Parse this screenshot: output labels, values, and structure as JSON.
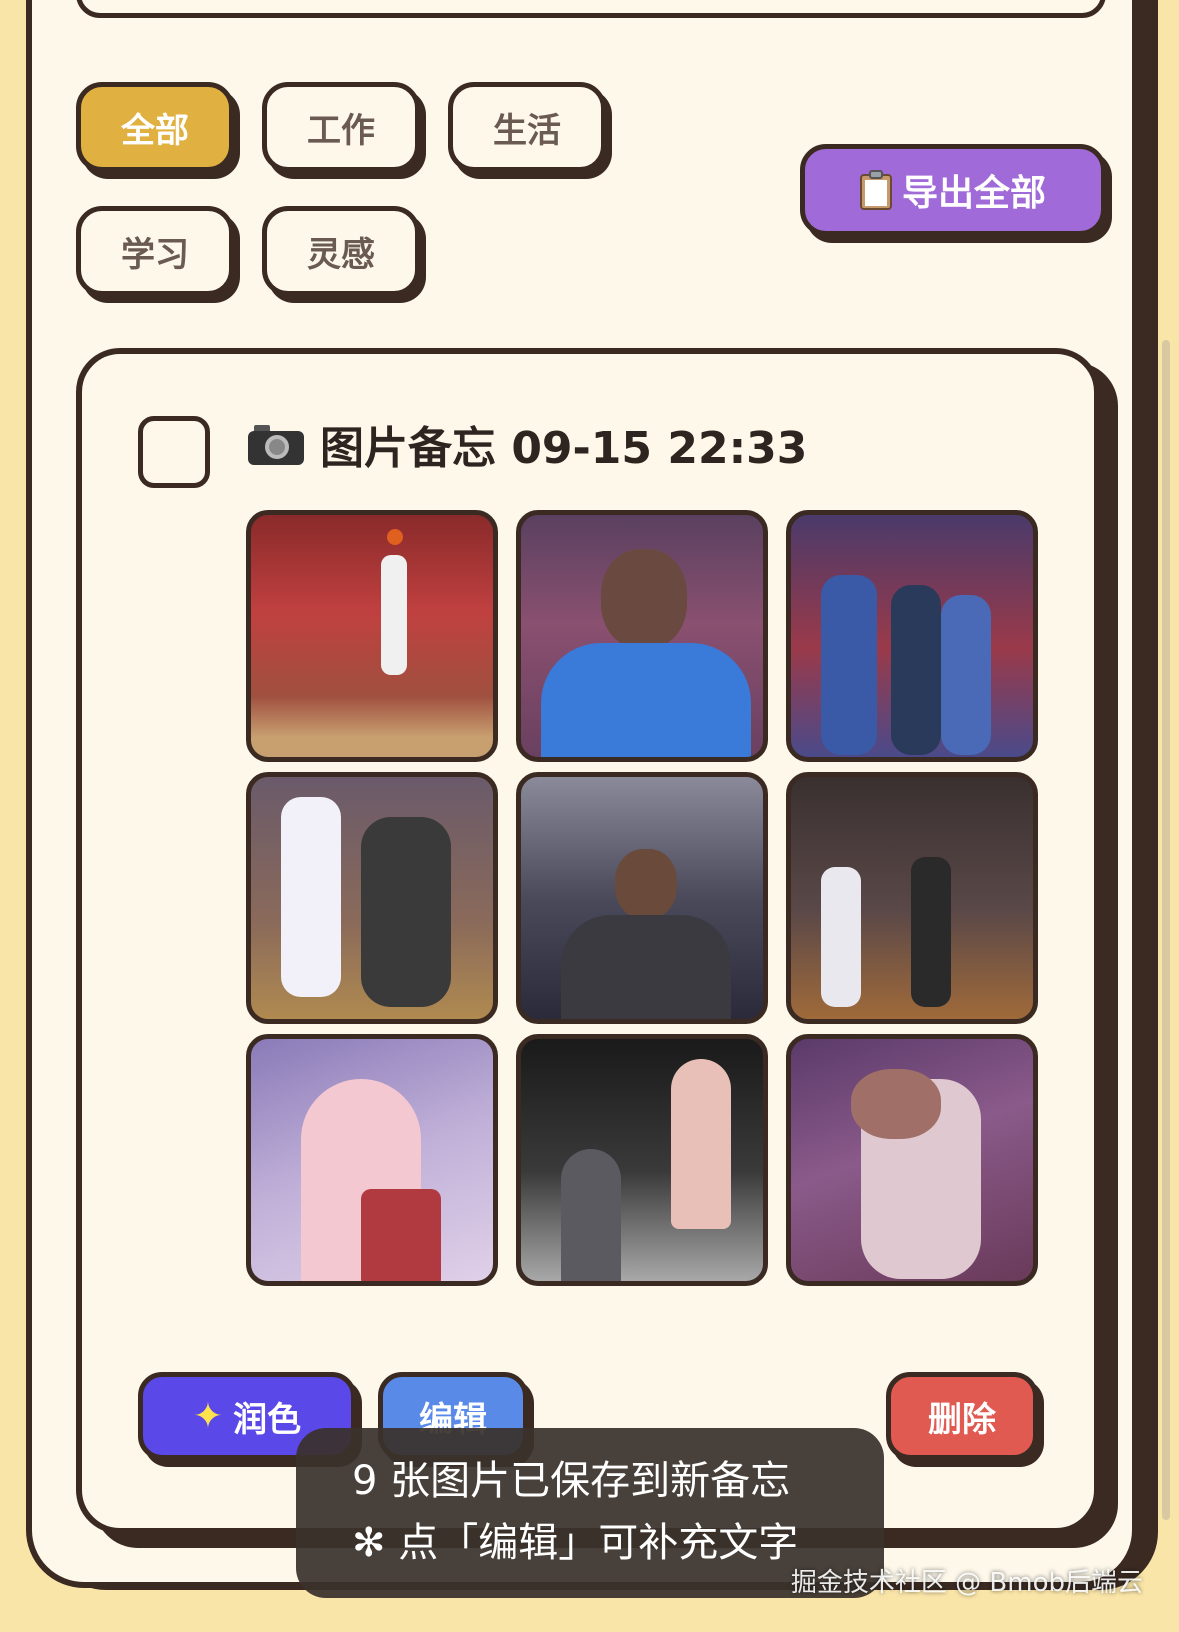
{
  "filters": {
    "all": "全部",
    "work": "工作",
    "life": "生活",
    "study": "学习",
    "inspiration": "灵感"
  },
  "export_label": "导出全部",
  "memo": {
    "title": "图片备忘 09-15 22:33",
    "image_count": 9
  },
  "actions": {
    "polish": "润色",
    "edit": "编辑",
    "delete": "删除"
  },
  "toast": {
    "line1": "9 张图片已保存到新备忘",
    "line2": "✻ 点「编辑」可补充文字"
  },
  "watermark": "掘金技术社区 @ Bmob后端云",
  "colors": {
    "accent_active": "#e0b040",
    "export": "#a06ad8",
    "polish": "#5a48e8",
    "edit": "#5a8ae8",
    "delete": "#e05a52",
    "outline": "#3a2a22"
  },
  "icons": {
    "export": "clipboard-icon",
    "memo": "camera-icon",
    "polish": "sparkles-icon"
  }
}
